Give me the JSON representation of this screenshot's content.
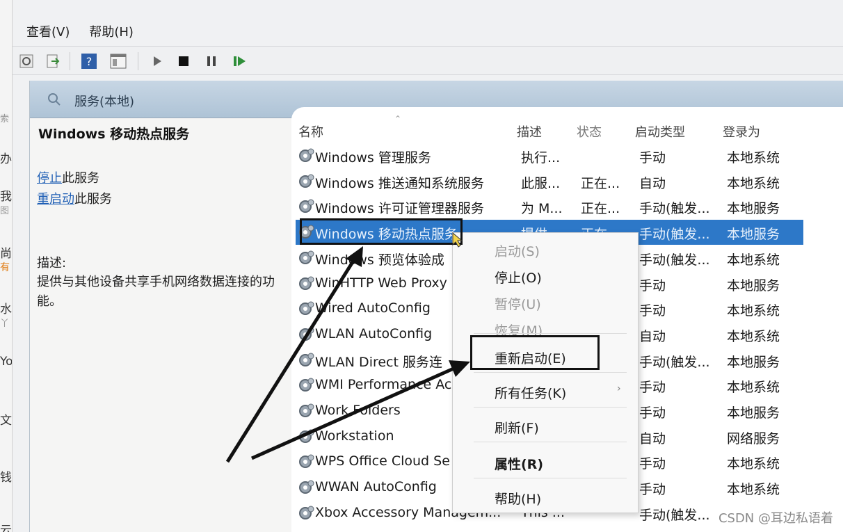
{
  "menu": {
    "view": "查看(V)",
    "help": "帮助(H)"
  },
  "left_strip": [
    "索",
    "办 ·",
    "我",
    "图",
    "尚",
    "有",
    "水",
    "丫",
    "Yo",
    "文",
    "钱",
    "云"
  ],
  "pane": {
    "title": "服务(本地)"
  },
  "left_pane": {
    "service_name": "Windows 移动热点服务",
    "stop_link": "停止",
    "stop_suffix": "此服务",
    "restart_link": "重启动",
    "restart_suffix": "此服务",
    "desc_label": "描述:",
    "desc_text": "提供与其他设备共享手机网络数据连接的功能。"
  },
  "columns": {
    "name": "名称",
    "desc": "描述",
    "status": "状态",
    "startup": "启动类型",
    "logon": "登录为"
  },
  "rows": [
    {
      "name": "Windows 管理服务",
      "desc": "执行...",
      "status": "",
      "startup": "手动",
      "logon": "本地系统"
    },
    {
      "name": "Windows 推送通知系统服务",
      "desc": "此服...",
      "status": "正在...",
      "startup": "自动",
      "logon": "本地系统"
    },
    {
      "name": "Windows 许可证管理器服务",
      "desc": "为 M...",
      "status": "正在...",
      "startup": "手动(触发...",
      "logon": "本地服务"
    },
    {
      "name": "Windows 移动热点服务",
      "desc": "提供...",
      "status": "正在...",
      "startup": "手动(触发...",
      "logon": "本地服务"
    },
    {
      "name": "Windows 预览体验成",
      "desc": "",
      "status": "",
      "startup": "手动(触发...",
      "logon": "本地系统"
    },
    {
      "name": "WinHTTP Web Proxy",
      "desc": "",
      "status": "",
      "startup": "手动",
      "logon": "本地服务"
    },
    {
      "name": "Wired AutoConfig",
      "desc": "",
      "status": "",
      "startup": "手动",
      "logon": "本地系统"
    },
    {
      "name": "WLAN AutoConfig",
      "desc": "",
      "status": "",
      "startup": "自动",
      "logon": "本地系统"
    },
    {
      "name": "WLAN Direct 服务连",
      "desc": "",
      "status": "",
      "startup": "手动(触发...",
      "logon": "本地服务"
    },
    {
      "name": "WMI Performance Ac",
      "desc": "",
      "status": "",
      "startup": "手动",
      "logon": "本地系统"
    },
    {
      "name": "Work Folders",
      "desc": "",
      "status": "",
      "startup": "手动",
      "logon": "本地服务"
    },
    {
      "name": "Workstation",
      "desc": "",
      "status": "",
      "startup": "自动",
      "logon": "网络服务"
    },
    {
      "name": "WPS Office Cloud Se",
      "desc": "",
      "status": "",
      "startup": "手动",
      "logon": "本地系统"
    },
    {
      "name": "WWAN AutoConfig",
      "desc": "",
      "status": "",
      "startup": "手动",
      "logon": "本地系统"
    },
    {
      "name": "Xbox Accessory Managem...",
      "desc": "This ...",
      "status": "",
      "startup": "手动(触发...",
      "logon": ""
    }
  ],
  "context_menu": {
    "start": "启动(S)",
    "stop": "停止(O)",
    "pause": "暂停(U)",
    "resume": "恢复(M)",
    "restart": "重新启动(E)",
    "all_tasks": "所有任务(K)",
    "refresh": "刷新(F)",
    "properties": "属性(R)",
    "help": "帮助(H)"
  },
  "watermark": "CSDN @耳边私语着",
  "colors": {
    "selection": "#2d78c8",
    "header_band": "#aec3d6",
    "link": "#1f5fb5",
    "annotation": "#111111"
  }
}
